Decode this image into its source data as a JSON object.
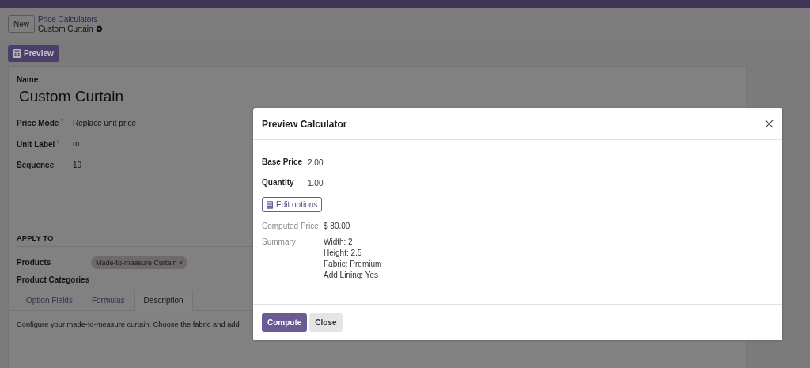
{
  "breadcrumb": {
    "new_button": "New",
    "parent": "Price Calculators",
    "current": "Custom Curtain"
  },
  "preview_button": "Preview",
  "form": {
    "name_label": "Name",
    "name": "Custom Curtain",
    "fields": [
      {
        "label": "Price Mode",
        "help": "?",
        "value": "Replace unit price"
      },
      {
        "label": "Unit Label",
        "help": "?",
        "value": "m"
      },
      {
        "label": "Sequence",
        "value": "10"
      }
    ],
    "section": "APPLY TO",
    "products_label": "Products",
    "product_tags": [
      {
        "label": "Made-to-measure Curtain",
        "remove": "×"
      }
    ],
    "categories_label": "Product Categories",
    "tabs": [
      {
        "label": "Option Fields",
        "selected": false
      },
      {
        "label": "Formulas",
        "selected": false
      },
      {
        "label": "Description",
        "selected": true
      }
    ],
    "description": "Configure your made-to-measure curtain. Choose the fabric and add"
  },
  "dialog": {
    "title": "Preview Calculator",
    "inputs": [
      {
        "label": "Base Price",
        "value": "2.00"
      },
      {
        "label": "Quantity",
        "value": "1.00"
      }
    ],
    "edit_button": "Edit options",
    "computed_label": "Computed Price",
    "computed_value": "$ 80.00",
    "summary_label": "Summary",
    "summary_lines": [
      "Width: 2",
      "Height: 2.5",
      "Fabric: Premium",
      "Add Lining: Yes"
    ],
    "buttons": [
      {
        "label": "Compute",
        "kind": "primary"
      },
      {
        "label": "Close",
        "kind": "secondary"
      }
    ]
  }
}
